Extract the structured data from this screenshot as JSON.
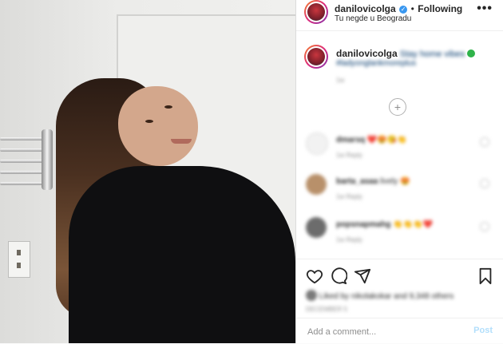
{
  "post": {
    "username": "danilovicolga",
    "separator": "•",
    "follow_label": "Following",
    "location": "Tu negde u Beogradu",
    "more_label": "•••",
    "caption": "Stay home vibes",
    "hashtags": "#ladyonglankmoreplus",
    "caption_time": "1w"
  },
  "comments": [
    {
      "user": "dmarsq",
      "text": "❤️😍😘👏",
      "meta": "1w   Reply"
    },
    {
      "user": "barta_asaa",
      "text": "lively 😍",
      "meta": "1w   Reply"
    },
    {
      "user": "popsnapmahg",
      "text": "👏👏👏❤️",
      "meta": "1w   Reply"
    }
  ],
  "load_more": "+",
  "actions": {
    "likes": "Liked by nikolakokar and 9,348 others",
    "date": "DECEMBER 5"
  },
  "add_comment": {
    "placeholder": "Add a comment...",
    "post_label": "Post"
  },
  "colors": {
    "accent": "#3897f0",
    "post_disabled": "#b2dffc",
    "border": "#dbdbdb"
  }
}
